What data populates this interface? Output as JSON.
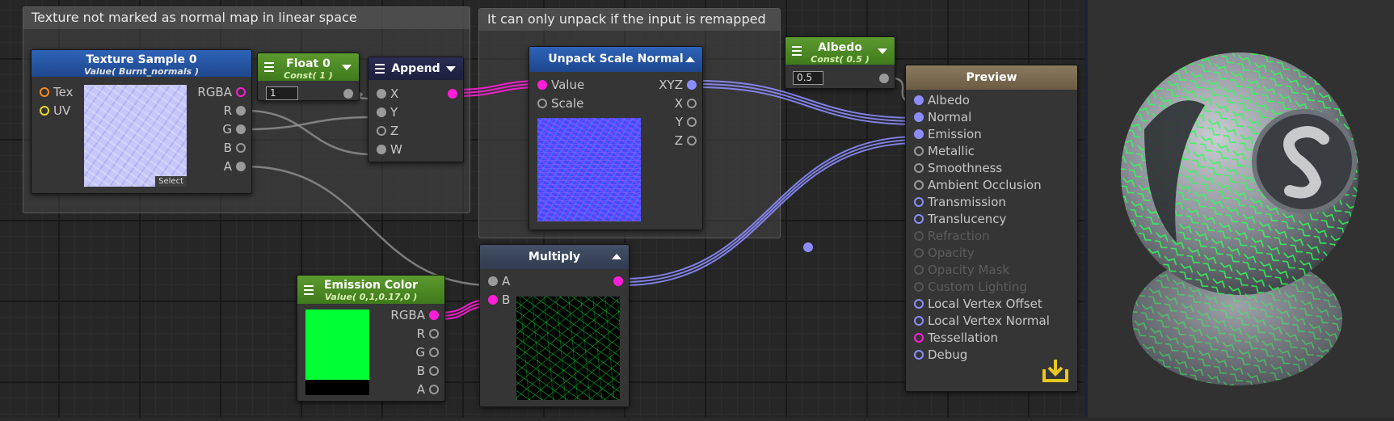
{
  "comments": {
    "left": "Texture not marked as normal map in linear space",
    "middle": "It can only unpack if the input is remapped"
  },
  "texture_sample": {
    "title": "Texture Sample 0",
    "subtitle": "Value( Burnt_normals )",
    "inputs": [
      "Tex",
      "UV"
    ],
    "outputs": [
      "RGBA",
      "R",
      "G",
      "B",
      "A"
    ],
    "select_label": "Select"
  },
  "float_node": {
    "title": "Float 0",
    "subtitle": "Const( 1 )",
    "value": "1"
  },
  "append_node": {
    "title": "Append",
    "inputs": [
      "X",
      "Y",
      "Z",
      "W"
    ]
  },
  "unpack_node": {
    "title": "Unpack Scale Normal",
    "inputs": [
      "Value",
      "Scale"
    ],
    "outputs": [
      "XYZ",
      "X",
      "Y",
      "Z"
    ]
  },
  "albedo_node": {
    "title": "Albedo",
    "subtitle": "Const( 0.5 )",
    "value": "0.5"
  },
  "emission_node": {
    "title": "Emission Color",
    "subtitle": "Value( 0,1,0.17,0 )",
    "outputs": [
      "RGBA",
      "R",
      "G",
      "B",
      "A"
    ],
    "color": "#00ff33"
  },
  "multiply_node": {
    "title": "Multiply",
    "inputs": [
      "A",
      "B"
    ]
  },
  "preview_node": {
    "title": "Preview",
    "inputs": [
      {
        "label": "Albedo",
        "state": "connected"
      },
      {
        "label": "Normal",
        "state": "connected"
      },
      {
        "label": "Emission",
        "state": "connected"
      },
      {
        "label": "Metallic",
        "state": "gray"
      },
      {
        "label": "Smoothness",
        "state": "gray"
      },
      {
        "label": "Ambient Occlusion",
        "state": "gray"
      },
      {
        "label": "Transmission",
        "state": "purple"
      },
      {
        "label": "Translucency",
        "state": "purple"
      },
      {
        "label": "Refraction",
        "state": "disabled"
      },
      {
        "label": "Opacity",
        "state": "disabled"
      },
      {
        "label": "Opacity Mask",
        "state": "disabled"
      },
      {
        "label": "Custom Lighting",
        "state": "disabled"
      },
      {
        "label": "Local Vertex Offset",
        "state": "purple"
      },
      {
        "label": "Local Vertex Normal",
        "state": "purple"
      },
      {
        "label": "Tessellation",
        "state": "magenta"
      },
      {
        "label": "Debug",
        "state": "purple"
      }
    ]
  },
  "colors": {
    "wire_magenta": "#ff1ed8",
    "wire_purple": "#8c8cff",
    "wire_gray": "#9a9a9a",
    "accent_emission": "#00ff33"
  },
  "icons": {
    "menu": "menu-icon",
    "collapse": "triangle-icon",
    "save": "save-icon"
  }
}
